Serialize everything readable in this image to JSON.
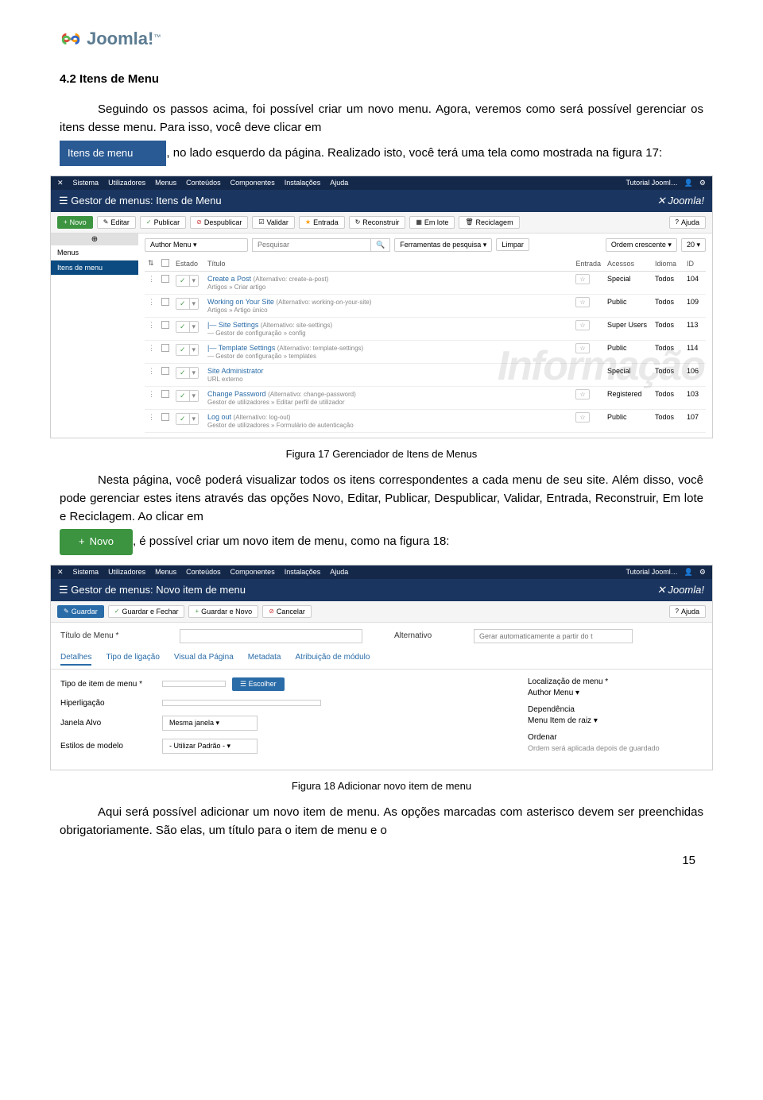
{
  "logo": {
    "name": "Joomla!",
    "tm": "™"
  },
  "h": {
    "title": "4.2 Itens de Menu"
  },
  "p1": "Seguindo os passos acima, foi possível criar um novo menu. Agora, veremos como será possível gerenciar os itens desse menu. Para isso, você deve clicar em",
  "p1b": ", no lado esquerdo da página. Realizado isto, você terá uma tela como mostrada na figura 17:",
  "btn_itens": "Itens de menu",
  "cap17": "Figura 17 Gerenciador de Itens de Menus",
  "p2a": "Nesta página, você poderá visualizar todos os itens correspondentes a cada menu de seu site. Além disso, você pode gerenciar estes itens através das opções Novo, Editar, Publicar, Despublicar, Validar, Entrada, Reconstruir, Em lote e Reciclagem. Ao clicar em",
  "p2b": ", é possível criar um novo item de menu, como na figura 18:",
  "btn_novo": "Novo",
  "cap18": "Figura 18  Adicionar novo item de menu",
  "p3": "Aqui será possível adicionar um novo item de menu. As opções marcadas com asterisco devem ser preenchidas obrigatoriamente. São elas, um título para o item de menu e o",
  "pagenum": "15",
  "admin": {
    "menus": [
      "Sistema",
      "Utilizadores",
      "Menus",
      "Conteúdos",
      "Componentes",
      "Instalações",
      "Ajuda"
    ],
    "right": "Tutorial Jooml…",
    "gear": "⚙"
  },
  "s17": {
    "title": "Gestor de menus: Itens de Menu",
    "brand": "Joomla!",
    "toolbar": {
      "novo": "Novo",
      "editar": "Editar",
      "publicar": "Publicar",
      "despublicar": "Despublicar",
      "validar": "Validar",
      "entrada": "Entrada",
      "reconstruir": "Reconstruir",
      "emlote": "Em lote",
      "reciclagem": "Reciclagem",
      "ajuda": "Ajuda"
    },
    "side": {
      "p1": "Menus",
      "p2": "Itens de menu"
    },
    "filter": {
      "menu": "Author Menu",
      "search": "Pesquisar",
      "tools": "Ferramentas de pesquisa",
      "limpar": "Limpar",
      "order": "Ordem crescente",
      "pp": "20"
    },
    "cols": {
      "estado": "Estado",
      "titulo": "Título",
      "entrada": "Entrada",
      "acessos": "Acessos",
      "idioma": "Idioma",
      "id": "ID"
    },
    "rows": [
      {
        "t": "Create a Post",
        "alt": "(Alternativo: create-a-post)",
        "sub": "Artigos » Criar artigo",
        "acc": "Special",
        "lang": "Todos",
        "id": "104",
        "star": true
      },
      {
        "t": "Working on Your Site",
        "alt": "(Alternativo: working-on-your-site)",
        "sub": "Artigos » Artigo único",
        "acc": "Public",
        "lang": "Todos",
        "id": "109",
        "star": true
      },
      {
        "t": "|— Site Settings",
        "alt": "(Alternativo: site-settings)",
        "sub": "— Gestor de configuração » config",
        "acc": "Super Users",
        "lang": "Todos",
        "id": "113",
        "star": true
      },
      {
        "t": "|— Template Settings",
        "alt": "(Alternativo: template-settings)",
        "sub": "— Gestor de configuração » templates",
        "acc": "Public",
        "lang": "Todos",
        "id": "114",
        "star": true
      },
      {
        "t": "Site Administrator",
        "alt": "",
        "sub": "URL externo",
        "acc": "Special",
        "lang": "Todos",
        "id": "106",
        "star": false
      },
      {
        "t": "Change Password",
        "alt": "(Alternativo: change-password)",
        "sub": "Gestor de utilizadores » Editar perfil de utilizador",
        "acc": "Registered",
        "lang": "Todos",
        "id": "103",
        "star": true
      },
      {
        "t": "Log out",
        "alt": "(Alternativo: log-out)",
        "sub": "Gestor de utilizadores » Formulário de autenticação",
        "acc": "Public",
        "lang": "Todos",
        "id": "107",
        "star": true
      }
    ]
  },
  "s18": {
    "title": "Gestor de menus: Novo item de menu",
    "toolbar": {
      "guardar": "Guardar",
      "gfechar": "Guardar e Fechar",
      "gnovo": "Guardar e Novo",
      "cancelar": "Cancelar",
      "ajuda": "Ajuda"
    },
    "ftitle": "Título de Menu *",
    "falt": "Alternativo",
    "faltph": "Gerar automaticamente a partir do t",
    "tabs": [
      "Detalhes",
      "Tipo de ligação",
      "Visual da Página",
      "Metadata",
      "Atribuição de módulo"
    ],
    "left": {
      "tipo": "Tipo de item de menu *",
      "escolher": "Escolher",
      "hiper": "Hiperligação",
      "janela": "Janela Alvo",
      "janelav": "Mesma janela",
      "estilo": "Estilos de modelo",
      "estilov": "- Utilizar Padrão -"
    },
    "right": {
      "loc": "Localização de menu *",
      "locv": "Author Menu",
      "dep": "Dependência",
      "depv": "Menu Item de raiz",
      "ord": "Ordenar",
      "ordv": "Ordem será aplicada depois de guardado"
    }
  }
}
